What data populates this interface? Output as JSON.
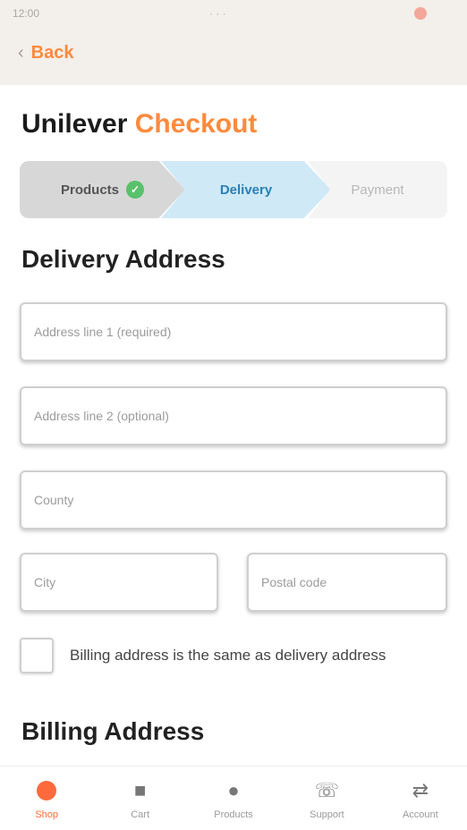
{
  "status_bar": {
    "time": "12:00",
    "center": "·  ·  ·"
  },
  "header": {
    "back_label": "Back"
  },
  "page": {
    "title_part1": "Unilever",
    "title_part2": "Checkout"
  },
  "steps": [
    {
      "label": "Products",
      "state": "done"
    },
    {
      "label": "Delivery",
      "state": "active"
    },
    {
      "label": "Payment",
      "state": "pending"
    }
  ],
  "delivery": {
    "heading": "Delivery Address",
    "fields": {
      "address1": {
        "placeholder": "Address line 1 (required)"
      },
      "address2": {
        "placeholder": "Address line 2 (optional)"
      },
      "county": {
        "placeholder": "County"
      },
      "city": {
        "placeholder": "City"
      },
      "postal": {
        "placeholder": "Postal code"
      }
    },
    "same_billing_label": "Billing address is the same as delivery address"
  },
  "billing": {
    "heading": "Billing Address"
  },
  "nav": [
    {
      "label": "Shop",
      "icon": "shop-icon"
    },
    {
      "label": "Cart",
      "icon": "cart-icon"
    },
    {
      "label": "Products",
      "icon": "products-icon"
    },
    {
      "label": "Support",
      "icon": "support-icon"
    },
    {
      "label": "Account",
      "icon": "account-icon"
    }
  ],
  "colors": {
    "accent": "#ff8a3d",
    "active_step": "#cfe9f7",
    "done_check": "#59c16b",
    "header_bg": "#f3efea"
  }
}
